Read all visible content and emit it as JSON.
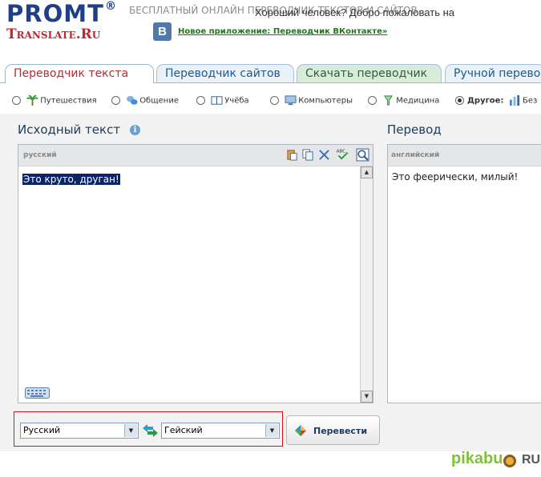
{
  "header": {
    "logo_line1": "PROMT",
    "logo_reg": "®",
    "logo_line2": "Translate.Ru",
    "slogan": "БЕСПЛАТНЫЙ ОНЛАЙН ПЕРЕВОДЧИК ТЕКСТОВ И САЙТОВ",
    "vk_icon_letter": "В",
    "vk_link": "Новое приложение: Переводчик ВКонтакте»"
  },
  "tabs": [
    {
      "label": "Переводчик текста"
    },
    {
      "label": "Переводчик сайтов"
    },
    {
      "label": "Скачать переводчик"
    },
    {
      "label": "Ручной перевод"
    }
  ],
  "topics": [
    {
      "label": "Путешествия",
      "icon": "palm-tree-icon"
    },
    {
      "label": "Общение",
      "icon": "speech-bubbles-icon"
    },
    {
      "label": "Учёба",
      "icon": "book-icon"
    },
    {
      "label": "Компьютеры",
      "icon": "monitor-icon"
    },
    {
      "label": "Медицина",
      "icon": "medicine-icon"
    },
    {
      "label": "Другое:",
      "icon": "bar-chart-icon",
      "selected": true
    },
    {
      "label": "Без"
    }
  ],
  "source": {
    "title": "Исходный текст",
    "info_icon": "i",
    "lang": "русский",
    "text": "Это круто, друган!"
  },
  "target": {
    "title": "Перевод",
    "lang": "английский",
    "text": "Это феерически, милый!"
  },
  "controls": {
    "from_lang": "Русский",
    "to_lang": "Гейский",
    "translate_button": "Перевести"
  },
  "footer": {
    "text": "Хороший человек? Добро пожаловать на",
    "brand": "pikabu",
    "brand_suffix": "RU"
  },
  "colors": {
    "brand_blue": "#1f3f86",
    "brand_red": "#c1272d",
    "selection": "#0a246a",
    "highlight_box": "#dd1111",
    "pikabu_green": "#7ec13a"
  }
}
